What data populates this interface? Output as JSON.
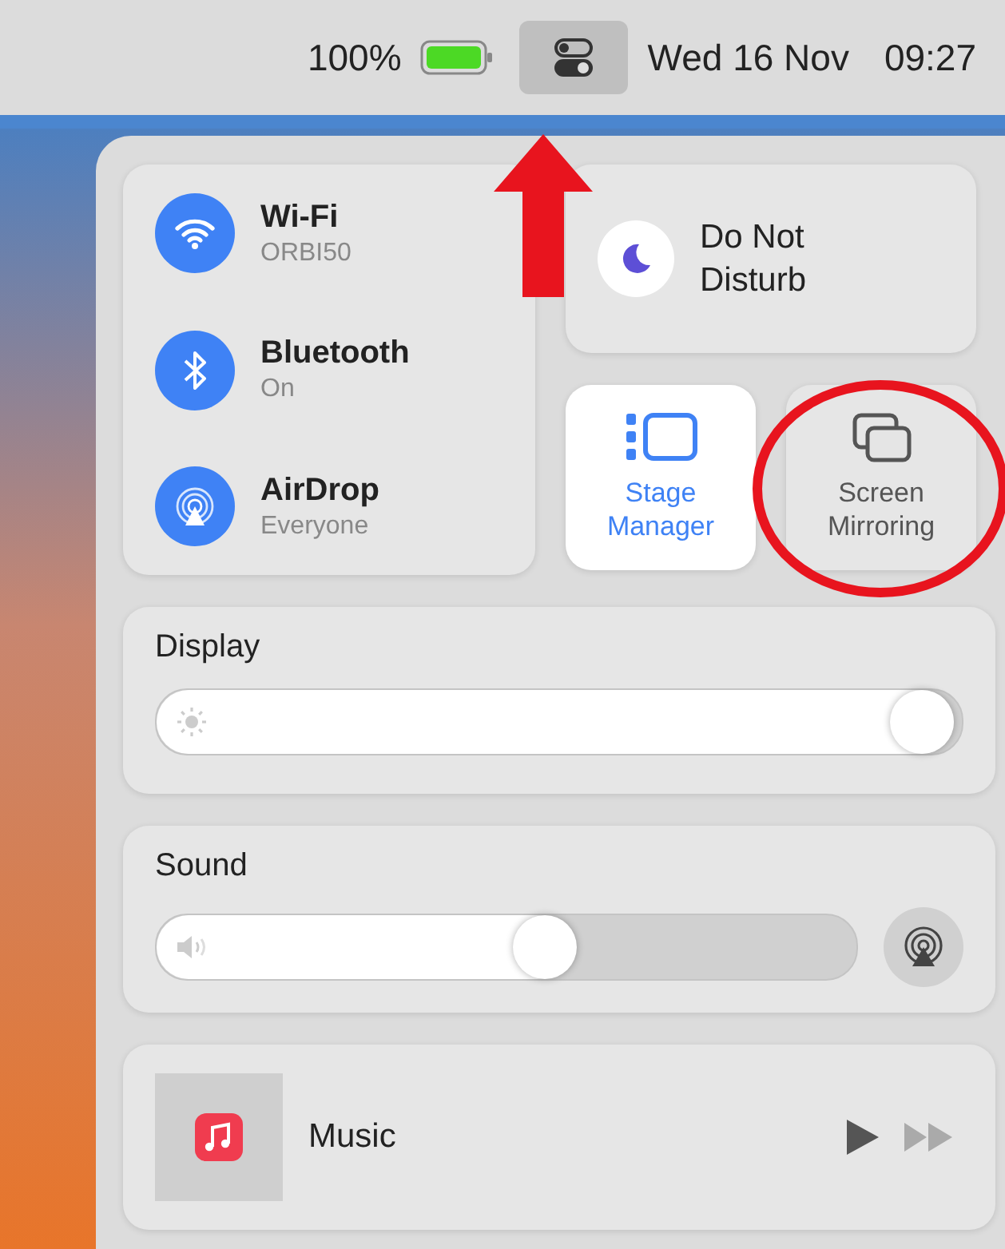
{
  "menu_bar": {
    "battery_percent": "100%",
    "control_center_selected": true,
    "date": "Wed 16 Nov",
    "time": "09:27"
  },
  "connectivity": [
    {
      "name": "Wi-Fi",
      "status": "ORBI50",
      "on": true
    },
    {
      "name": "Bluetooth",
      "status": "On",
      "on": true
    },
    {
      "name": "AirDrop",
      "status": "Everyone",
      "on": true
    }
  ],
  "focus": {
    "label": "Do Not Disturb"
  },
  "tiles": [
    {
      "kind": "stage",
      "label": "Stage Manager",
      "on": true
    },
    {
      "kind": "mirror",
      "label": "Screen Mirroring",
      "on": false
    }
  ],
  "sliders": [
    {
      "kind": "display",
      "label": "Display",
      "level": 0.99
    },
    {
      "kind": "sound",
      "label": "Sound",
      "level": 0.56
    }
  ],
  "now_playing": {
    "app": "Music"
  }
}
